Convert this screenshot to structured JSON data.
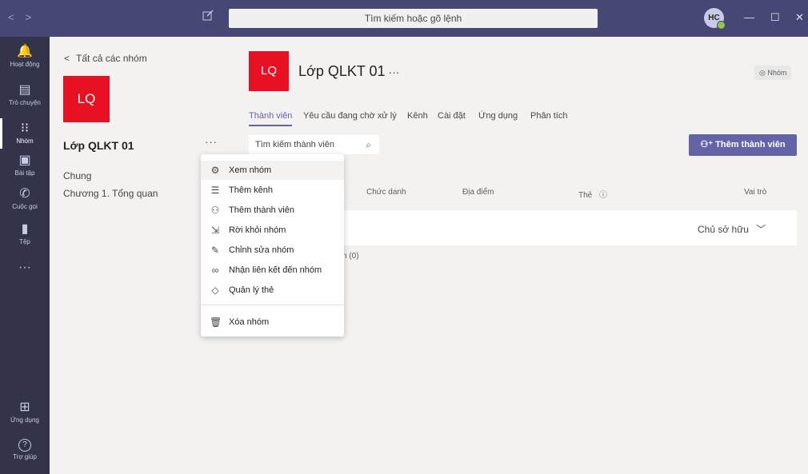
{
  "titlebar": {
    "nav_back": "<",
    "nav_forward": ">",
    "search_placeholder": "Tìm kiếm hoặc gõ lệnh",
    "avatar_initials": "HC",
    "minimize": "—",
    "maximize": "☐",
    "close": "✕"
  },
  "rail": {
    "items": [
      {
        "label": "Hoạt động",
        "icon": "bell-icon",
        "glyph": "🔔"
      },
      {
        "label": "Trò chuyện",
        "icon": "chat-icon",
        "glyph": "▤"
      },
      {
        "label": "Nhóm",
        "icon": "teams-icon",
        "glyph": "⁝⁝"
      },
      {
        "label": "Bài tập",
        "icon": "assignments-icon",
        "glyph": "▣"
      },
      {
        "label": "Cuộc gọi",
        "icon": "phone-icon",
        "glyph": "✆"
      },
      {
        "label": "Tệp",
        "icon": "file-icon",
        "glyph": "▮"
      },
      {
        "label": "",
        "icon": "more-icon",
        "glyph": "···"
      }
    ],
    "apps_label": "Ứng dụng",
    "apps_glyph": "⊞",
    "help_label": "Trợ giúp",
    "help_glyph": "?"
  },
  "teampanel": {
    "back_label": "Tất cả các nhóm",
    "back_glyph": "<",
    "avatar_initials": "LQ",
    "team_name": "Lớp QLKT 01",
    "more_glyph": "···",
    "channels": [
      "Chung",
      "Chương 1. Tổng quan"
    ]
  },
  "main": {
    "avatar_initials": "LQ",
    "title": "Lớp QLKT 01",
    "title_more": "···",
    "badge_icon": "◎",
    "badge_label": "Nhóm",
    "tabs": [
      "Thành viên",
      "Yêu cầu đang chờ xử lý",
      "Kênh",
      "Cài đặt",
      "Ứng dụng",
      "Phân tích"
    ],
    "search_placeholder": "Tìm kiếm thành viên",
    "search_glyph": "⌕",
    "add_button": "Thêm thành viên",
    "add_glyph": "⚇⁺",
    "columns": [
      "Chức danh",
      "Địa điểm",
      "Thẻ",
      "Vai trò"
    ],
    "tag_info_glyph": "ⓘ",
    "owner_role": "Chủ sở hữu",
    "owner_chevron": "﹀",
    "guests_fragment": "n (0)"
  },
  "menu": {
    "items": [
      {
        "label": "Xem nhóm",
        "icon": "settings-icon",
        "glyph": "⚙"
      },
      {
        "label": "Thêm kênh",
        "icon": "add-channel-icon",
        "glyph": "☰"
      },
      {
        "label": "Thêm thành viên",
        "icon": "add-member-icon",
        "glyph": "⚇"
      },
      {
        "label": "Rời khỏi nhóm",
        "icon": "leave-icon",
        "glyph": "⇲"
      },
      {
        "label": "Chỉnh sửa nhóm",
        "icon": "edit-icon",
        "glyph": "✎"
      },
      {
        "label": "Nhận liên kết đến nhóm",
        "icon": "link-icon",
        "glyph": "∞"
      },
      {
        "label": "Quản lý thẻ",
        "icon": "tag-icon",
        "glyph": "◇"
      },
      {
        "label": "Xóa nhóm",
        "icon": "trash-icon",
        "glyph": "🗑"
      }
    ]
  },
  "colors": {
    "accent": "#6264a7",
    "titlebar": "#464775",
    "rail": "#33344a",
    "team_red": "#e81123"
  }
}
